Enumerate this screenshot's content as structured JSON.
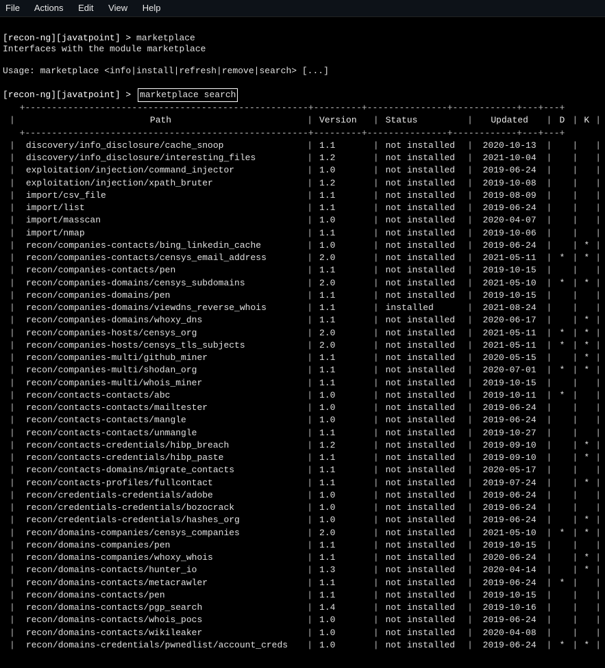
{
  "menubar": {
    "items": [
      "File",
      "Actions",
      "Edit",
      "View",
      "Help"
    ]
  },
  "prompt1": {
    "before": "[recon-ng][javatpoint] > ",
    "cmd": "marketplace",
    "desc": "Interfaces with the module marketplace"
  },
  "usage": "Usage: marketplace <info|install|refresh|remove|search> [...]",
  "prompt2": {
    "before": "[recon-ng][javatpoint] > ",
    "cmd": "marketplace search"
  },
  "table": {
    "headers": {
      "path": "Path",
      "version": "Version",
      "status": "Status",
      "updated": "Updated",
      "d": "D",
      "k": "K"
    },
    "rows": [
      {
        "path": "discovery/info_disclosure/cache_snoop",
        "version": "1.1",
        "status": "not installed",
        "updated": "2020-10-13",
        "d": "",
        "k": ""
      },
      {
        "path": "discovery/info_disclosure/interesting_files",
        "version": "1.2",
        "status": "not installed",
        "updated": "2021-10-04",
        "d": "",
        "k": ""
      },
      {
        "path": "exploitation/injection/command_injector",
        "version": "1.0",
        "status": "not installed",
        "updated": "2019-06-24",
        "d": "",
        "k": ""
      },
      {
        "path": "exploitation/injection/xpath_bruter",
        "version": "1.2",
        "status": "not installed",
        "updated": "2019-10-08",
        "d": "",
        "k": ""
      },
      {
        "path": "import/csv_file",
        "version": "1.1",
        "status": "not installed",
        "updated": "2019-08-09",
        "d": "",
        "k": ""
      },
      {
        "path": "import/list",
        "version": "1.1",
        "status": "not installed",
        "updated": "2019-06-24",
        "d": "",
        "k": ""
      },
      {
        "path": "import/masscan",
        "version": "1.0",
        "status": "not installed",
        "updated": "2020-04-07",
        "d": "",
        "k": ""
      },
      {
        "path": "import/nmap",
        "version": "1.1",
        "status": "not installed",
        "updated": "2019-10-06",
        "d": "",
        "k": ""
      },
      {
        "path": "recon/companies-contacts/bing_linkedin_cache",
        "version": "1.0",
        "status": "not installed",
        "updated": "2019-06-24",
        "d": "",
        "k": "*"
      },
      {
        "path": "recon/companies-contacts/censys_email_address",
        "version": "2.0",
        "status": "not installed",
        "updated": "2021-05-11",
        "d": "*",
        "k": "*"
      },
      {
        "path": "recon/companies-contacts/pen",
        "version": "1.1",
        "status": "not installed",
        "updated": "2019-10-15",
        "d": "",
        "k": ""
      },
      {
        "path": "recon/companies-domains/censys_subdomains",
        "version": "2.0",
        "status": "not installed",
        "updated": "2021-05-10",
        "d": "*",
        "k": "*"
      },
      {
        "path": "recon/companies-domains/pen",
        "version": "1.1",
        "status": "not installed",
        "updated": "2019-10-15",
        "d": "",
        "k": ""
      },
      {
        "path": "recon/companies-domains/viewdns_reverse_whois",
        "version": "1.1",
        "status": "installed",
        "updated": "2021-08-24",
        "d": "",
        "k": ""
      },
      {
        "path": "recon/companies-domains/whoxy_dns",
        "version": "1.1",
        "status": "not installed",
        "updated": "2020-06-17",
        "d": "",
        "k": "*"
      },
      {
        "path": "recon/companies-hosts/censys_org",
        "version": "2.0",
        "status": "not installed",
        "updated": "2021-05-11",
        "d": "*",
        "k": "*"
      },
      {
        "path": "recon/companies-hosts/censys_tls_subjects",
        "version": "2.0",
        "status": "not installed",
        "updated": "2021-05-11",
        "d": "*",
        "k": "*"
      },
      {
        "path": "recon/companies-multi/github_miner",
        "version": "1.1",
        "status": "not installed",
        "updated": "2020-05-15",
        "d": "",
        "k": "*"
      },
      {
        "path": "recon/companies-multi/shodan_org",
        "version": "1.1",
        "status": "not installed",
        "updated": "2020-07-01",
        "d": "*",
        "k": "*"
      },
      {
        "path": "recon/companies-multi/whois_miner",
        "version": "1.1",
        "status": "not installed",
        "updated": "2019-10-15",
        "d": "",
        "k": ""
      },
      {
        "path": "recon/contacts-contacts/abc",
        "version": "1.0",
        "status": "not installed",
        "updated": "2019-10-11",
        "d": "*",
        "k": ""
      },
      {
        "path": "recon/contacts-contacts/mailtester",
        "version": "1.0",
        "status": "not installed",
        "updated": "2019-06-24",
        "d": "",
        "k": ""
      },
      {
        "path": "recon/contacts-contacts/mangle",
        "version": "1.0",
        "status": "not installed",
        "updated": "2019-06-24",
        "d": "",
        "k": ""
      },
      {
        "path": "recon/contacts-contacts/unmangle",
        "version": "1.1",
        "status": "not installed",
        "updated": "2019-10-27",
        "d": "",
        "k": ""
      },
      {
        "path": "recon/contacts-credentials/hibp_breach",
        "version": "1.2",
        "status": "not installed",
        "updated": "2019-09-10",
        "d": "",
        "k": "*"
      },
      {
        "path": "recon/contacts-credentials/hibp_paste",
        "version": "1.1",
        "status": "not installed",
        "updated": "2019-09-10",
        "d": "",
        "k": "*"
      },
      {
        "path": "recon/contacts-domains/migrate_contacts",
        "version": "1.1",
        "status": "not installed",
        "updated": "2020-05-17",
        "d": "",
        "k": ""
      },
      {
        "path": "recon/contacts-profiles/fullcontact",
        "version": "1.1",
        "status": "not installed",
        "updated": "2019-07-24",
        "d": "",
        "k": "*"
      },
      {
        "path": "recon/credentials-credentials/adobe",
        "version": "1.0",
        "status": "not installed",
        "updated": "2019-06-24",
        "d": "",
        "k": ""
      },
      {
        "path": "recon/credentials-credentials/bozocrack",
        "version": "1.0",
        "status": "not installed",
        "updated": "2019-06-24",
        "d": "",
        "k": ""
      },
      {
        "path": "recon/credentials-credentials/hashes_org",
        "version": "1.0",
        "status": "not installed",
        "updated": "2019-06-24",
        "d": "",
        "k": "*"
      },
      {
        "path": "recon/domains-companies/censys_companies",
        "version": "2.0",
        "status": "not installed",
        "updated": "2021-05-10",
        "d": "*",
        "k": "*"
      },
      {
        "path": "recon/domains-companies/pen",
        "version": "1.1",
        "status": "not installed",
        "updated": "2019-10-15",
        "d": "",
        "k": ""
      },
      {
        "path": "recon/domains-companies/whoxy_whois",
        "version": "1.1",
        "status": "not installed",
        "updated": "2020-06-24",
        "d": "",
        "k": "*"
      },
      {
        "path": "recon/domains-contacts/hunter_io",
        "version": "1.3",
        "status": "not installed",
        "updated": "2020-04-14",
        "d": "",
        "k": "*"
      },
      {
        "path": "recon/domains-contacts/metacrawler",
        "version": "1.1",
        "status": "not installed",
        "updated": "2019-06-24",
        "d": "*",
        "k": ""
      },
      {
        "path": "recon/domains-contacts/pen",
        "version": "1.1",
        "status": "not installed",
        "updated": "2019-10-15",
        "d": "",
        "k": ""
      },
      {
        "path": "recon/domains-contacts/pgp_search",
        "version": "1.4",
        "status": "not installed",
        "updated": "2019-10-16",
        "d": "",
        "k": ""
      },
      {
        "path": "recon/domains-contacts/whois_pocs",
        "version": "1.0",
        "status": "not installed",
        "updated": "2019-06-24",
        "d": "",
        "k": ""
      },
      {
        "path": "recon/domains-contacts/wikileaker",
        "version": "1.0",
        "status": "not installed",
        "updated": "2020-04-08",
        "d": "",
        "k": ""
      },
      {
        "path": "recon/domains-credentials/pwnedlist/account_creds",
        "version": "1.0",
        "status": "not installed",
        "updated": "2019-06-24",
        "d": "*",
        "k": "*"
      }
    ]
  }
}
